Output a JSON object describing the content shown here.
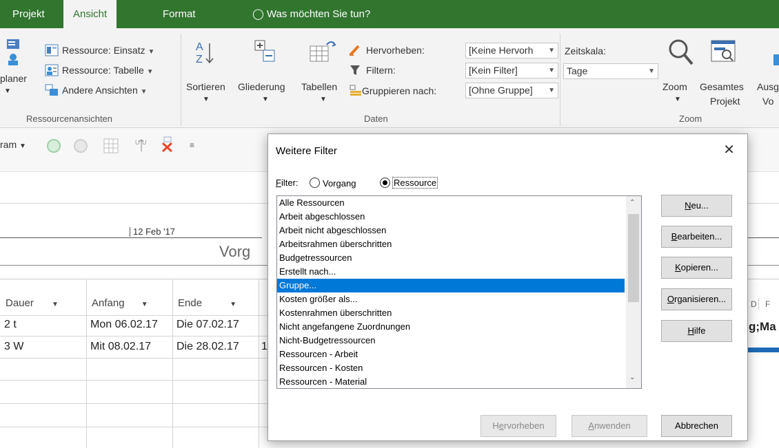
{
  "tabs": [
    {
      "label": "Projekt"
    },
    {
      "label": "Ansicht"
    },
    {
      "label": "Format"
    }
  ],
  "tell_me": "Was möchten Sie tun?",
  "ribbon": {
    "planer_label": "planer",
    "res_einsatz": "Ressource: Einsatz",
    "res_tabelle": "Ressource: Tabelle",
    "andere": "Andere Ansichten",
    "group_ressourcen": "Ressourcenansichten",
    "sortieren": "Sortieren",
    "gliederung": "Gliederung",
    "tabellen": "Tabellen",
    "hervorheben": "Hervorheben:",
    "filtern": "Filtern:",
    "gruppieren": "Gruppieren nach:",
    "dd_hervorheben": "[Keine Hervorh",
    "dd_filter": "[Kein Filter]",
    "dd_gruppe": "[Ohne Gruppe]",
    "group_daten": "Daten",
    "zeitskala": "Zeitskala:",
    "dd_zeitskala": "Tage",
    "zoom": "Zoom",
    "gesamtes": "Gesamtes",
    "projekt": "Projekt",
    "ausg": "Ausg",
    "vo": "Vo",
    "group_zoom": "Zoom"
  },
  "toolbar2": {
    "dropdown": "ram"
  },
  "timeline": {
    "date": "12 Feb '17",
    "vorg": "Vorg"
  },
  "grid": {
    "headers": [
      "Dauer",
      "Anfang",
      "Ende"
    ],
    "rows": [
      {
        "dauer": "2 t",
        "anfang": "Mon 06.02.17",
        "ende": "Die 07.02.17",
        "extra": ""
      },
      {
        "dauer": "3 W",
        "anfang": "Mit 08.02.17",
        "ende": "Die 28.02.17",
        "extra": "1"
      }
    ],
    "gantt_headers": [
      "D",
      "F"
    ],
    "gantt_label": "g;Ma"
  },
  "dialog": {
    "title": "Weitere Filter",
    "filter_label": "Filter:",
    "radio_vorgang": "Vorgang",
    "radio_ressource": "Ressource",
    "items": [
      "Alle Ressourcen",
      "Arbeit abgeschlossen",
      "Arbeit nicht abgeschlossen",
      "Arbeitsrahmen überschritten",
      "Budgetressourcen",
      "Erstellt nach...",
      "Gruppe...",
      "Kosten größer als...",
      "Kostenrahmen überschritten",
      "Nicht angefangene Zuordnungen",
      "Nicht-Budgetressourcen",
      "Ressourcen - Arbeit",
      "Ressourcen - Kosten",
      "Ressourcen - Material"
    ],
    "selected_item": "Gruppe...",
    "buttons": {
      "neu": "Neu...",
      "bearbeiten": "Bearbeiten...",
      "kopieren": "Kopieren...",
      "organisieren": "Organisieren...",
      "hilfe": "Hilfe",
      "hervorheben": "Hervorheben",
      "anwenden": "Anwenden",
      "abbrechen": "Abbrechen"
    }
  },
  "colors": {
    "tab_green": "#31752f",
    "selection_blue": "#0078d7",
    "gantt_bar": "#1e6bb8"
  }
}
